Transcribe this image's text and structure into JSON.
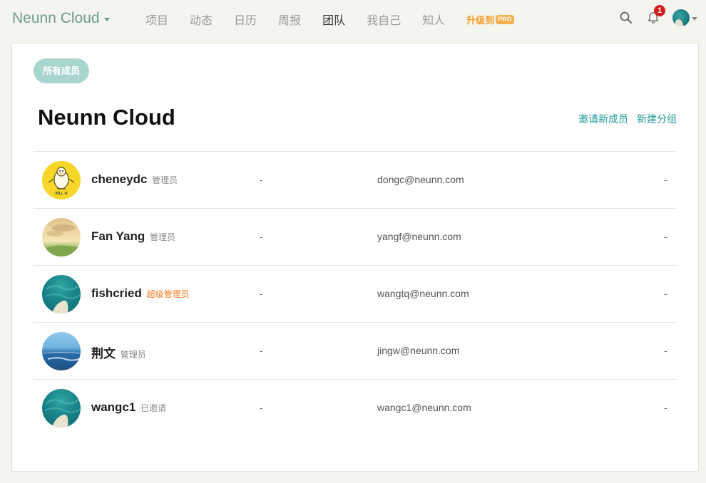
{
  "brand": {
    "name": "Neunn Cloud"
  },
  "nav": {
    "items": [
      "项目",
      "动态",
      "日历",
      "周报",
      "团队",
      "我自己",
      "知人"
    ],
    "active": "团队",
    "upgrade_label": "升级到",
    "pro_label": "PRO"
  },
  "notifications": {
    "count": "1"
  },
  "team": {
    "group_label": "所有成员",
    "title": "Neunn Cloud",
    "invite_label": "邀请新成员",
    "new_group_label": "新建分组"
  },
  "members": [
    {
      "name": "cheneydc",
      "role": "管理员",
      "role_type": "admin",
      "field1": "-",
      "email": "dongc@neunn.com",
      "field2": "-",
      "avatar": "penguin"
    },
    {
      "name": "Fan Yang",
      "role": "管理员",
      "role_type": "admin",
      "field1": "-",
      "email": "yangf@neunn.com",
      "field2": "-",
      "avatar": "sky"
    },
    {
      "name": "fishcried",
      "role": "超级管理员",
      "role_type": "super",
      "field1": "-",
      "email": "wangtq@neunn.com",
      "field2": "-",
      "avatar": "sea"
    },
    {
      "name": "荆文",
      "role": "管理员",
      "role_type": "admin",
      "field1": "-",
      "email": "jingw@neunn.com",
      "field2": "-",
      "avatar": "ocean"
    },
    {
      "name": "wangc1",
      "role": "已邀请",
      "role_type": "invited",
      "field1": "-",
      "email": "wangc1@neunn.com",
      "field2": "-",
      "avatar": "sea"
    }
  ],
  "penguin_avatar_text": "KILL -9",
  "colors": {
    "brand": "#6d9a8c",
    "accent": "#1f9a9a",
    "upgrade": "#f59a23",
    "super_admin": "#f47b20",
    "badge": "#d31d1d",
    "pill": "#a9d5cf"
  }
}
